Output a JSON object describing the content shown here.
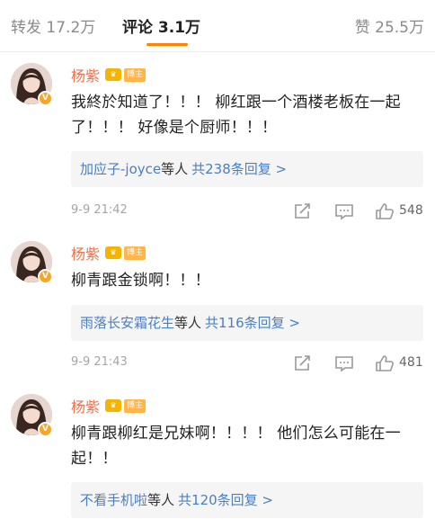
{
  "tabs": {
    "repost": "转发 17.2万",
    "comments": "评论 3.1万",
    "likes": "赞 25.5万"
  },
  "colors": {
    "accent": "#ff8200",
    "username": "#eb7350",
    "link": "#4a7fc1"
  },
  "badges": {
    "author": "博主"
  },
  "comments": [
    {
      "user": "杨紫",
      "text": "我終於知道了！！！ 柳红跟一个酒楼老板在一起了！！！ 好像是个厨师！！！",
      "reply_names": "加应子-joyce",
      "reply_suffix": "等人",
      "reply_count": "共238条回复 >",
      "date": "9-9 21:42",
      "likes": "548"
    },
    {
      "user": "杨紫",
      "text": "柳青跟金锁啊！！！",
      "reply_names": "雨落长安霜花生",
      "reply_suffix": "等人",
      "reply_count": "共116条回复 >",
      "date": "9-9 21:43",
      "likes": "481"
    },
    {
      "user": "杨紫",
      "text": "柳青跟柳红是兄妹啊！！！！ 他们怎么可能在一起！！",
      "reply_names": "不看手机啦",
      "reply_suffix": "等人",
      "reply_count": "共120条回复 >"
    }
  ],
  "icons": {
    "share": "share-icon",
    "reply": "comment-icon",
    "like": "thumb-up-icon",
    "verified": "verified-icon",
    "vip": "vip-crown-icon"
  }
}
